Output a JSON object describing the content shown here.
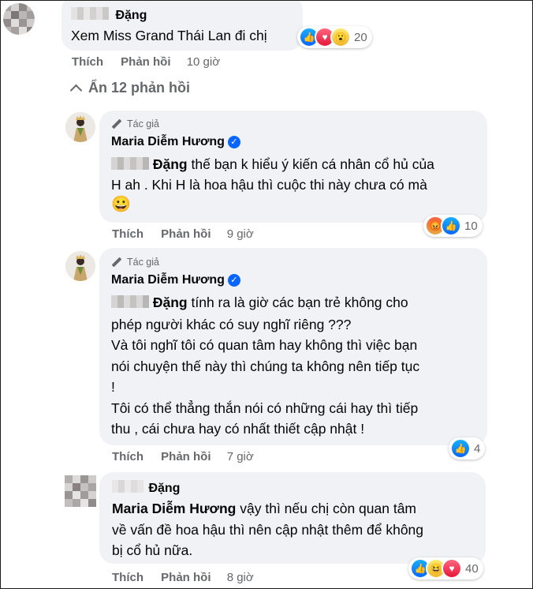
{
  "comment1": {
    "name": "Đặng",
    "text": "Xem Miss Grand Thái Lan đi chị",
    "reaction_count": "20",
    "reactions": [
      "like",
      "love",
      "wow"
    ],
    "actions": {
      "like": "Thích",
      "reply": "Phản hồi",
      "time": "10 giờ"
    }
  },
  "replies_toggle": {
    "label": "Ẩn 12 phản hồi"
  },
  "reply1": {
    "author_tag": "Tác giả",
    "name": "Maria Diễm Hương",
    "mention": "Đặng",
    "line1": "thế bạn k hiểu ý kiến cá nhân cổ hủ của",
    "line2": "H ah . Khi H là hoa hậu thì cuộc thi này chưa có mà",
    "emoji": "😀",
    "reaction_count": "10",
    "reactions": [
      "angry",
      "like"
    ],
    "actions": {
      "like": "Thích",
      "reply": "Phản hồi",
      "time": "9 giờ"
    }
  },
  "reply2": {
    "author_tag": "Tác giả",
    "name": "Maria Diễm Hương",
    "mention": "Đặng",
    "line1": "tính ra là giờ các bạn trẻ không cho",
    "line2": "phép người khác có suy nghĩ riêng ???",
    "line3": "Và tôi nghĩ tôi có quan tâm hay không thì việc bạn",
    "line4": "nói chuyện thế này thì chúng ta không nên tiếp tục",
    "line5": "!",
    "line6": "Tôi có thể thẳng thắn nói có những cái hay thì tiếp",
    "line7": "thu , cái chưa hay có nhất thiết cập nhật !",
    "reaction_count": "4",
    "reactions": [
      "like"
    ],
    "actions": {
      "like": "Thích",
      "reply": "Phản hồi",
      "time": "7 giờ"
    }
  },
  "reply3": {
    "name": "Đặng",
    "mention": "Maria Diễm Hương",
    "line1": "vậy thì nếu chị còn quan tâm",
    "line2": "về vấn đề hoa hậu thì nên cập nhật thêm để không",
    "line3": "bị cổ hủ nữa.",
    "reaction_count": "40",
    "reactions": [
      "like",
      "haha",
      "love"
    ],
    "actions": {
      "like": "Thích",
      "reply": "Phản hồi",
      "time": "8 giờ"
    }
  },
  "colors": {
    "bubble": "#f0f2f5",
    "muted": "#65676b",
    "like_blue": "#0866ff"
  }
}
